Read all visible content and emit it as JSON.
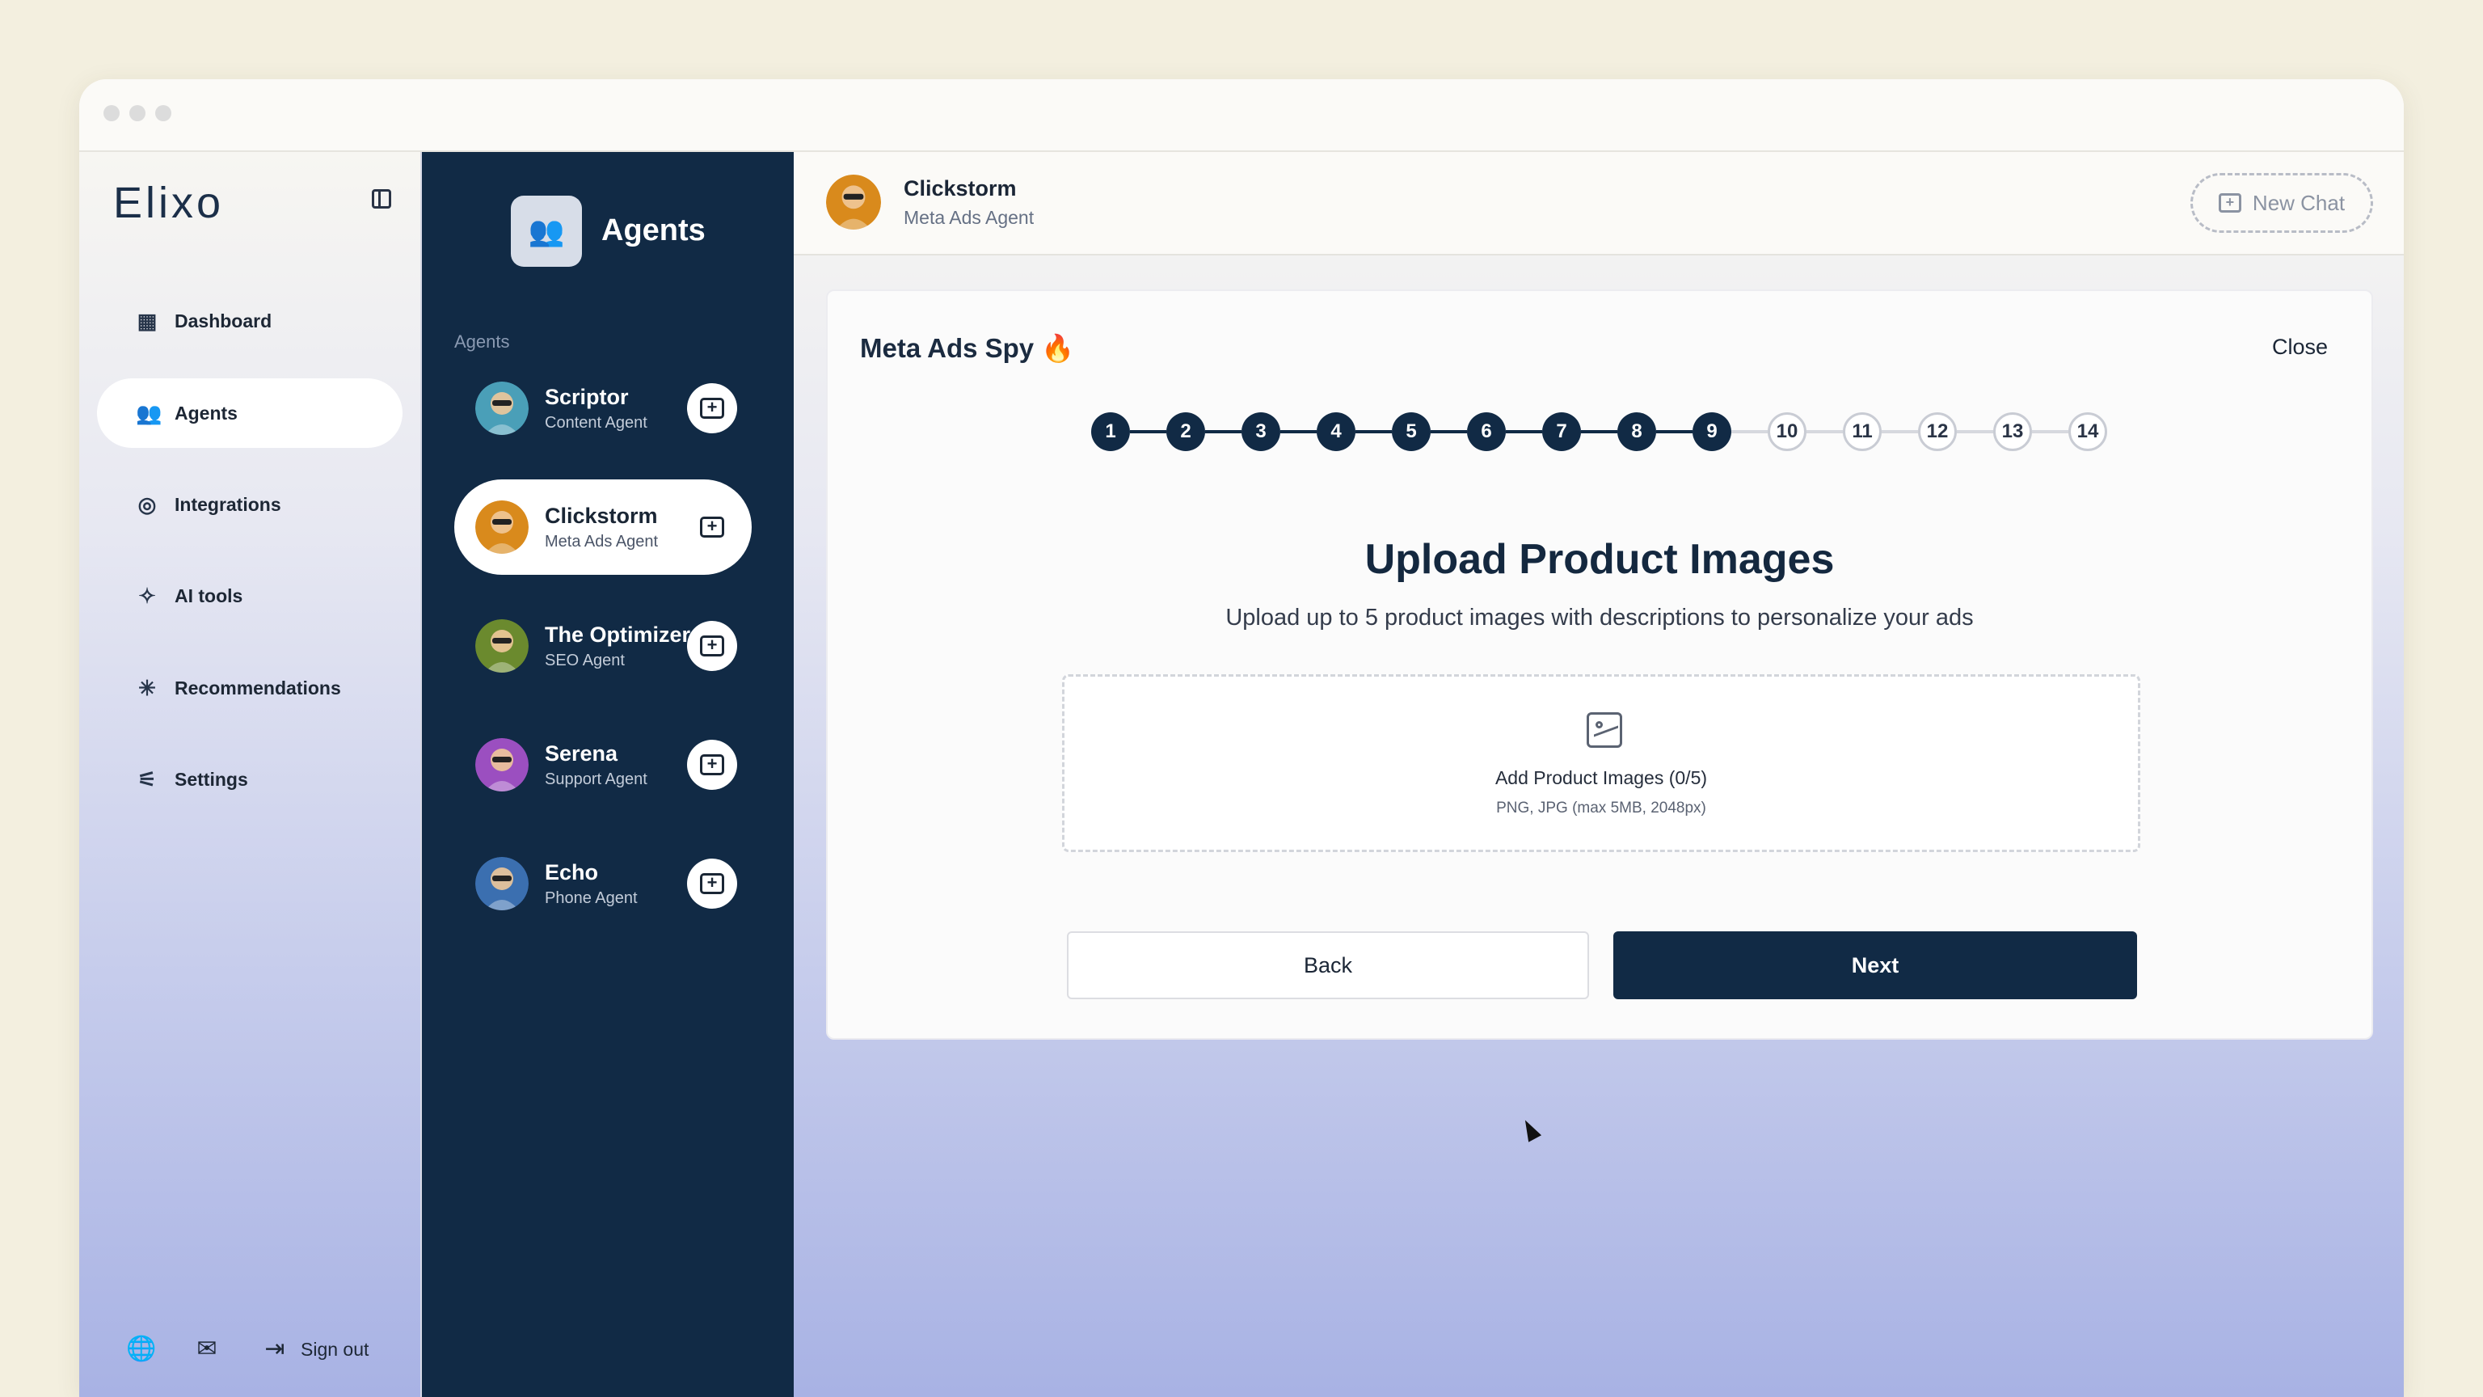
{
  "app": {
    "logo": "Elixo"
  },
  "nav": {
    "items": [
      {
        "label": "Dashboard",
        "icon": "dashboard-icon",
        "glyph": "▦",
        "active": false
      },
      {
        "label": "Agents",
        "icon": "agents-icon",
        "glyph": "👥",
        "active": true
      },
      {
        "label": "Integrations",
        "icon": "integrations-icon",
        "glyph": "◎",
        "active": false
      },
      {
        "label": "AI tools",
        "icon": "magic-wand-icon",
        "glyph": "✧",
        "active": false
      },
      {
        "label": "Recommendations",
        "icon": "sparkle-icon",
        "glyph": "✳",
        "active": false
      },
      {
        "label": "Settings",
        "icon": "sliders-icon",
        "glyph": "⚟",
        "active": false
      }
    ],
    "bottom": {
      "globe_glyph": "🌐",
      "mail_glyph": "✉",
      "signout_glyph": "⇥",
      "signout_label": "Sign out"
    }
  },
  "agents_panel": {
    "title": "Agents",
    "section_label": "Agents",
    "agents": [
      {
        "name": "Scriptor",
        "role": "Content Agent",
        "avatar_color": "#4a9fb8",
        "active": false
      },
      {
        "name": "Clickstorm",
        "role": "Meta Ads Agent",
        "avatar_color": "#d98a1c",
        "active": true
      },
      {
        "name": "The Optimizer",
        "role": "SEO Agent",
        "avatar_color": "#6b8a2e",
        "active": false
      },
      {
        "name": "Serena",
        "role": "Support Agent",
        "avatar_color": "#9b4fc0",
        "active": false
      },
      {
        "name": "Echo",
        "role": "Phone Agent",
        "avatar_color": "#3b6fb0",
        "active": false
      }
    ]
  },
  "topbar": {
    "agent_name": "Clickstorm",
    "agent_role": "Meta Ads Agent",
    "new_chat_label": "New Chat"
  },
  "wizard": {
    "title": "Meta Ads Spy 🔥",
    "close_label": "Close",
    "steps": [
      "1",
      "2",
      "3",
      "4",
      "5",
      "6",
      "7",
      "8",
      "9",
      "10",
      "11",
      "12",
      "13",
      "14"
    ],
    "completed_steps": 9,
    "heading": "Upload Product Images",
    "subheading": "Upload up to 5 product images with descriptions to personalize your ads",
    "dropzone_title": "Add Product Images (0/5)",
    "dropzone_hint": "PNG, JPG (max 5MB, 2048px)",
    "back_label": "Back",
    "next_label": "Next"
  },
  "colors": {
    "navy": "#112a45",
    "accent_orange": "#d98a1c"
  }
}
